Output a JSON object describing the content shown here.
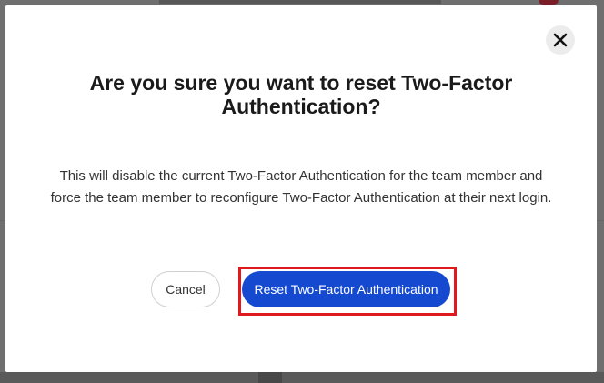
{
  "modal": {
    "title": "Are you sure you want to reset Two-Factor Authentication?",
    "body": "This will disable the current Two-Factor Authentication for the team member and force the team member to reconfigure Two-Factor Authentication at their next login.",
    "cancel_label": "Cancel",
    "confirm_label": "Reset Two-Factor Authentication",
    "close_icon": "close-icon"
  },
  "colors": {
    "primary": "#1449d0",
    "highlight": "#e0191f",
    "overlay": "#6f6f6f"
  }
}
